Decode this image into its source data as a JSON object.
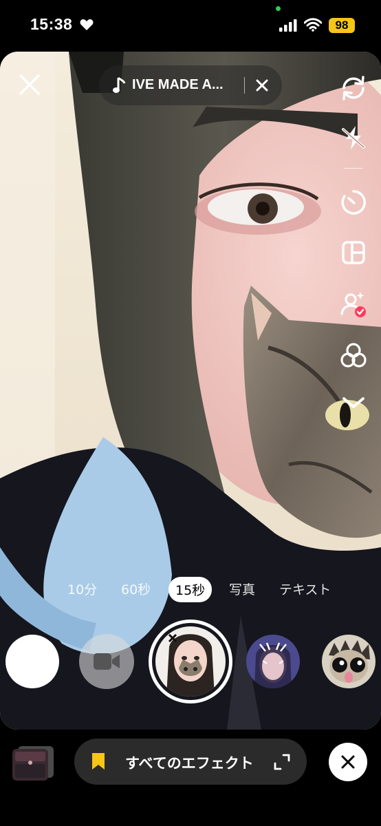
{
  "status_bar": {
    "time": "15:38",
    "battery": "98",
    "icons": [
      "heart-icon",
      "signal-icon",
      "wifi-icon",
      "battery-icon"
    ]
  },
  "music": {
    "title": "IVE MADE A..."
  },
  "toolbar": {
    "icons": [
      "flip-camera-icon",
      "flash-off-icon",
      "timer-icon",
      "layout-icon",
      "beauty-icon",
      "filters-icon",
      "chevron-down-icon"
    ]
  },
  "modes": [
    {
      "label": "10分"
    },
    {
      "label": "60秒"
    },
    {
      "label": "15秒",
      "active": true
    },
    {
      "label": "写真"
    },
    {
      "label": "テキスト"
    }
  ],
  "bottom": {
    "effects_label": "すべてのエフェクト"
  },
  "colors": {
    "battery": "#f5c518",
    "pill_bg": "#2b2b2b",
    "bookmark": "#f5c518",
    "status_dot": "#34c759"
  }
}
